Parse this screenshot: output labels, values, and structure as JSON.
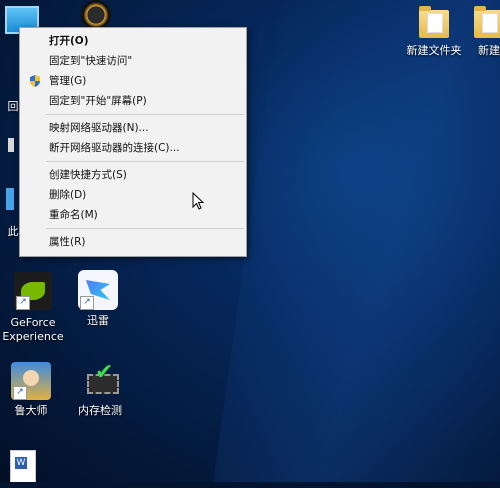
{
  "context_menu": {
    "items": [
      {
        "label": "打开(O)",
        "bold": true
      },
      {
        "label": "固定到\"快速访问\""
      },
      {
        "label": "管理(G)",
        "icon": "shield-icon"
      },
      {
        "label": "固定到\"开始\"屏幕(P)"
      },
      {
        "label": "映射网络驱动器(N)..."
      },
      {
        "label": "断开网络驱动器的连接(C)..."
      },
      {
        "label": "创建快捷方式(S)"
      },
      {
        "label": "删除(D)"
      },
      {
        "label": "重命名(M)"
      },
      {
        "label": "属性(R)"
      }
    ]
  },
  "desktop_icons": {
    "folder1": {
      "label": "新建文件夹"
    },
    "folder2": {
      "label": "新建"
    },
    "geforce": {
      "label": "GeForce Experience"
    },
    "xunlei": {
      "label": "迅雷"
    },
    "ludashi": {
      "label": "鲁大师"
    },
    "memtest": {
      "label": "内存检测"
    },
    "left_fragment_1": {
      "label": "此"
    },
    "left_fragment_2": {
      "label": "回"
    }
  },
  "colors": {
    "menu_bg": "#f2f2f2",
    "desktop_bg": "#06285c",
    "nvidia_green": "#76b900"
  }
}
